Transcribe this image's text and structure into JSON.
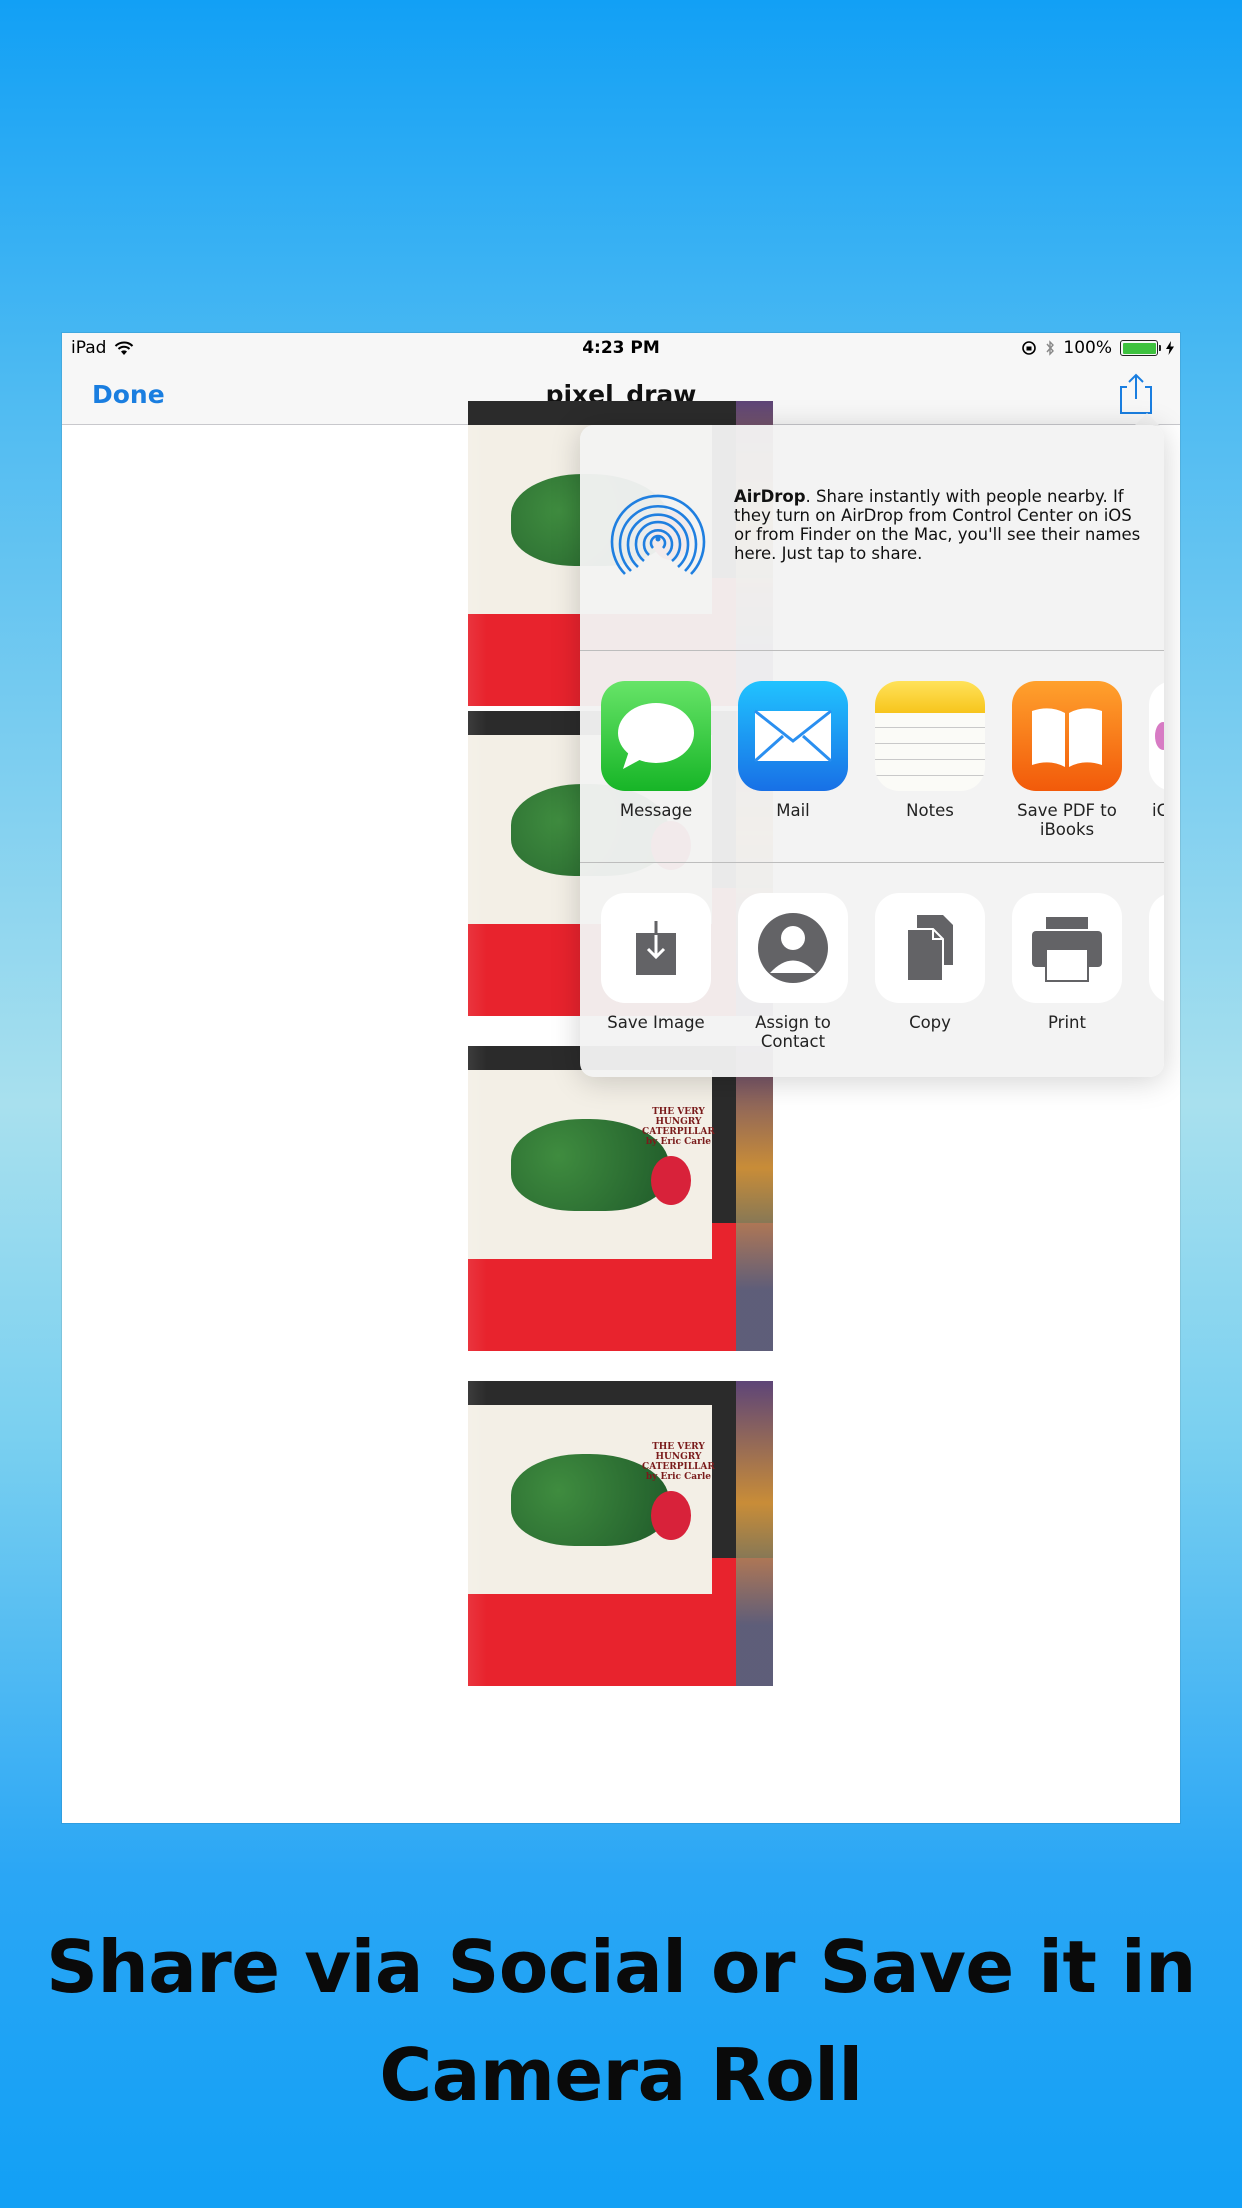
{
  "statusbar": {
    "device": "iPad",
    "time": "4:23 PM",
    "battery_percent": "100%",
    "battery_level": 1.0
  },
  "navbar": {
    "done_label": "Done",
    "title": "pixel_draw"
  },
  "photos": [
    {
      "book_title": ""
    },
    {
      "book_title": ""
    },
    {
      "book_title": "THE VERY HUNGRY CATERPILLAR by Eric Carle"
    },
    {
      "book_title": "THE VERY HUNGRY CATERPILLAR by Eric Carle"
    }
  ],
  "share_sheet": {
    "airdrop": {
      "title": "AirDrop",
      "text": ". Share instantly with people nearby. If they turn on AirDrop from Control Center on iOS or from Finder on the Mac, you'll see their names here. Just tap to share."
    },
    "apps": [
      {
        "label": "Message",
        "icon": "message-icon"
      },
      {
        "label": "Mail",
        "icon": "mail-icon"
      },
      {
        "label": "Notes",
        "icon": "notes-icon"
      },
      {
        "label": "Save PDF to iBooks",
        "icon": "ibooks-icon"
      },
      {
        "label": "iC",
        "icon": "icloud-icon"
      }
    ],
    "actions": [
      {
        "label": "Save Image",
        "icon": "save-image-icon"
      },
      {
        "label": "Assign to Contact",
        "icon": "contact-icon"
      },
      {
        "label": "Copy",
        "icon": "copy-icon"
      },
      {
        "label": "Print",
        "icon": "print-icon"
      }
    ]
  },
  "caption": {
    "line1": "Share via Social or Save it in",
    "line2": "Camera Roll"
  },
  "colors": {
    "accent": "#1a7ee0",
    "background_top": "#12a0f5"
  }
}
